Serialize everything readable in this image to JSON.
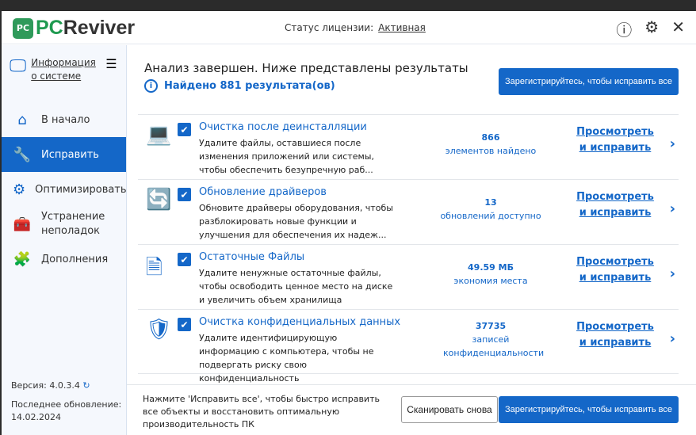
{
  "app": {
    "logo_badge": "PC",
    "logo_pc": "PC",
    "logo_reviver": "Reviver"
  },
  "header": {
    "license_label": "Статус лицензии:",
    "license_value": "Активная"
  },
  "sidebar": {
    "sysinfo": "Информация о системе",
    "items": [
      {
        "label": "В начало",
        "icon": "home-icon"
      },
      {
        "label": "Исправить",
        "icon": "wrench-icon",
        "active": true
      },
      {
        "label": "Оптимизировать",
        "icon": "gear-icon"
      },
      {
        "label": "Устранение неполадок",
        "icon": "toolbox-icon"
      },
      {
        "label": "Дополнения",
        "icon": "puzzle-icon"
      }
    ],
    "version_label": "Версия:",
    "version": "4.0.3.4",
    "updated_label": "Последнее обновление:",
    "updated": "14.02.2024"
  },
  "main": {
    "title": "Анализ завершен. Ниже представлены результаты",
    "found": "Найдено 881 результата(ов)",
    "fix_all": "Зарегистрируйтесь, чтобы исправить все",
    "rows": [
      {
        "name": "Очистка после деинсталляции",
        "desc": "Удалите файлы, оставшиеся после изменения приложений или системы, чтобы обеспечить безупречную раб...",
        "count": "866",
        "count_label": "элементов найдено",
        "action": "Просмотреть и исправить"
      },
      {
        "name": "Обновление драйверов",
        "desc": "Обновите драйверы оборудования, чтобы разблокировать новые функции и улучшения для обеспечения их надеж...",
        "count": "13",
        "count_label": "обновлений доступно",
        "action": "Просмотреть и исправить"
      },
      {
        "name": "Остаточные Файлы",
        "desc": "Удалите ненужные остаточные файлы, чтобы освободить ценное место на диске и увеличить объем хранилища",
        "count": "49.59 МБ",
        "count_label": "экономия места",
        "action": "Просмотреть и исправить"
      },
      {
        "name": "Очистка конфиденциальных данных",
        "desc": "Удалите идентифицирующую информацию с компьютера, чтобы не подвергать риску свою конфиденциальность",
        "count": "37735",
        "count_label": "записей конфиденциальности",
        "action": "Просмотреть и исправить"
      }
    ]
  },
  "footer": {
    "text": "Нажмите 'Исправить все', чтобы быстро исправить все объекты и восстановить оптимальную производительность ПК",
    "rescan": "Сканировать снова",
    "fix_all": "Зарегистрируйтесь, чтобы исправить все"
  }
}
